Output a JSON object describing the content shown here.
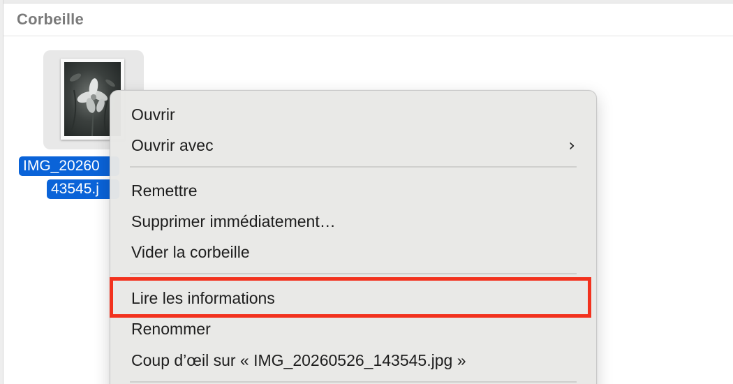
{
  "header": {
    "title": "Corbeille"
  },
  "file": {
    "name_line1": "IMG_20260",
    "name_line2": "43545.j",
    "thumbnail": "flower-photo"
  },
  "menu": {
    "items": [
      {
        "label": "Ouvrir"
      },
      {
        "label": "Ouvrir avec",
        "chevron": "›"
      },
      {
        "label": "Remettre"
      },
      {
        "label": "Supprimer immédiatement…"
      },
      {
        "label": "Vider la corbeille"
      },
      {
        "label": "Lire les informations"
      },
      {
        "label": "Renommer"
      },
      {
        "label": "Coup d’œil sur « IMG_20260526_143545.jpg »"
      }
    ]
  },
  "colors": {
    "selection": "#0a63d8",
    "highlight_border": "#f2321e",
    "menu_bg": "#e8e8e6",
    "header_text": "#7a7a7a"
  }
}
